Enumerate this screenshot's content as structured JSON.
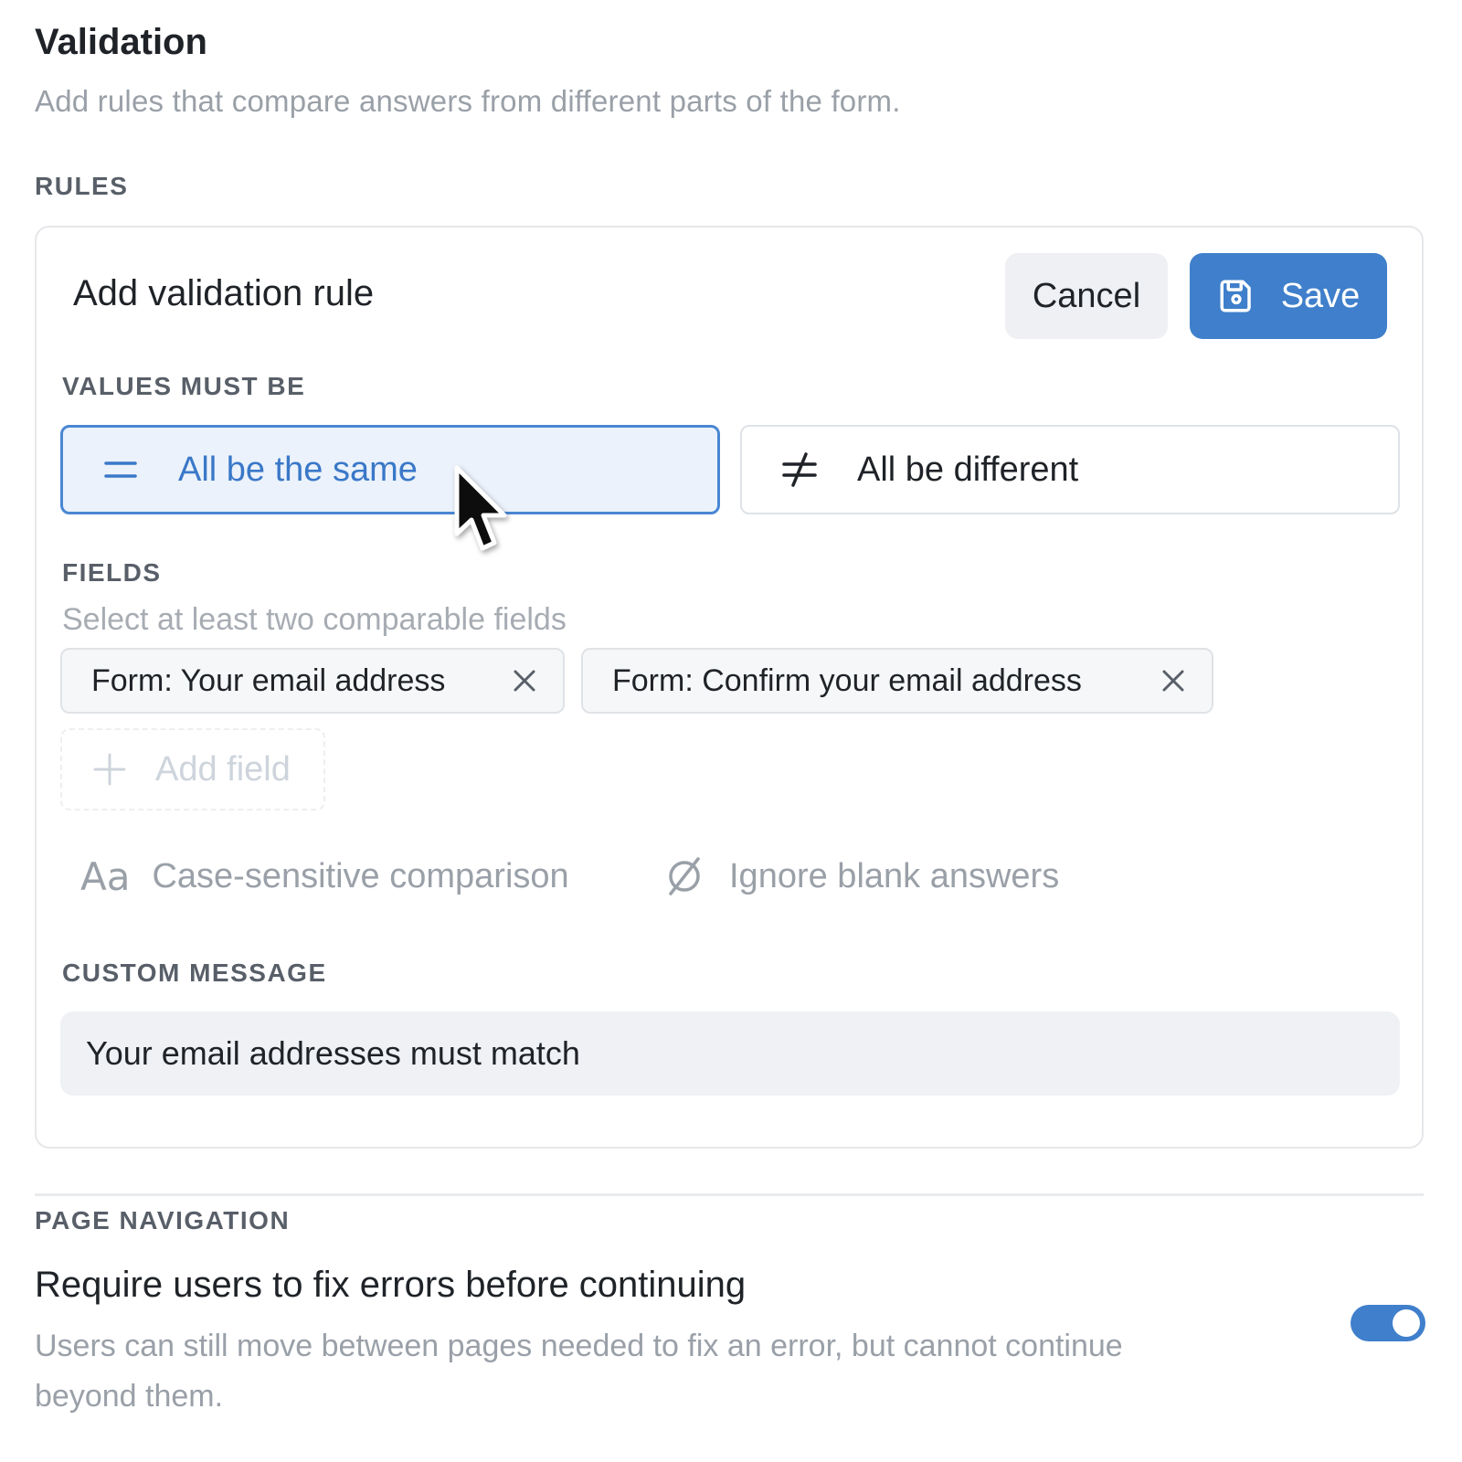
{
  "validation": {
    "title": "Validation",
    "description": "Add rules that compare answers from different parts of the form.",
    "rules_label": "RULES"
  },
  "rule_card": {
    "title": "Add validation rule",
    "cancel_label": "Cancel",
    "save_label": "Save",
    "values_label": "VALUES MUST BE",
    "options": [
      {
        "label": "All be the same",
        "icon": "equals-icon",
        "selected": true
      },
      {
        "label": "All be different",
        "icon": "not-equal-icon",
        "selected": false
      }
    ],
    "fields_label": "FIELDS",
    "fields_hint": "Select at least two comparable fields",
    "fields": [
      {
        "label": "Form: Your email address"
      },
      {
        "label": "Form: Confirm your email address"
      }
    ],
    "add_field_label": "Add field",
    "case_sensitive_icon": "Aa",
    "case_sensitive_label": "Case-sensitive comparison",
    "ignore_blank_label": "Ignore blank answers",
    "custom_message_label": "CUSTOM MESSAGE",
    "custom_message_value": "Your email addresses must match"
  },
  "page_navigation": {
    "label": "PAGE NAVIGATION",
    "title": "Require users to fix errors before continuing",
    "description": "Users can still move between pages needed to fix an error, but cannot continue beyond them.",
    "toggle_on": true
  },
  "colors": {
    "accent": "#3f7fcb",
    "selected_bg": "#ebf2fb",
    "muted_text": "#9aa0a8"
  }
}
